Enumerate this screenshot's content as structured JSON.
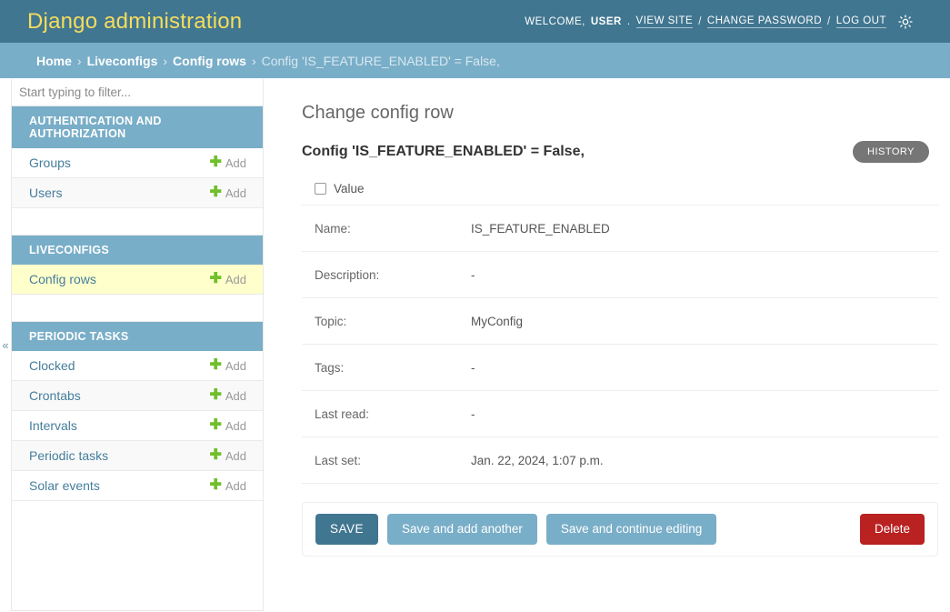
{
  "header": {
    "site_title": "Django administration",
    "welcome_prefix": "WELCOME,",
    "username": "USER",
    "username_suffix": ".",
    "view_site": "VIEW SITE",
    "sep1": "/",
    "change_password": "CHANGE PASSWORD",
    "sep2": "/",
    "log_out": "LOG OUT",
    "theme_icon": "sun-icon",
    "bg_color": "#417690",
    "brand_color": "#f5dd5d"
  },
  "breadcrumbs": {
    "items": [
      {
        "label": "Home",
        "current": false
      },
      {
        "label": "Liveconfigs",
        "current": false
      },
      {
        "label": "Config rows",
        "current": false
      },
      {
        "label": "Config 'IS_FEATURE_ENABLED' = False,",
        "current": true
      }
    ],
    "separator": "›",
    "bg_color": "#79aec8"
  },
  "sidebar": {
    "filter_placeholder": "Start typing to filter...",
    "filter_value": "",
    "collapse_icon": "«",
    "apps": [
      {
        "caption": "AUTHENTICATION AND AUTHORIZATION",
        "models": [
          {
            "name": "Groups",
            "add_label": "Add",
            "current": false
          },
          {
            "name": "Users",
            "add_label": "Add",
            "current": false
          }
        ]
      },
      {
        "caption": "LIVECONFIGS",
        "models": [
          {
            "name": "Config rows",
            "add_label": "Add",
            "current": true
          }
        ]
      },
      {
        "caption": "PERIODIC TASKS",
        "models": [
          {
            "name": "Clocked",
            "add_label": "Add",
            "current": false
          },
          {
            "name": "Crontabs",
            "add_label": "Add",
            "current": false
          },
          {
            "name": "Intervals",
            "add_label": "Add",
            "current": false
          },
          {
            "name": "Periodic tasks",
            "add_label": "Add",
            "current": false
          },
          {
            "name": "Solar events",
            "add_label": "Add",
            "current": false
          }
        ]
      }
    ],
    "current_highlight_color": "#ffffcc"
  },
  "main": {
    "page_title": "Change config row",
    "history_label": "HISTORY",
    "object_title": "Config 'IS_FEATURE_ENABLED' = False,",
    "value_checkbox": {
      "label": "Value",
      "checked": false
    },
    "fields": [
      {
        "label": "Name:",
        "value": "IS_FEATURE_ENABLED"
      },
      {
        "label": "Description:",
        "value": "-"
      },
      {
        "label": "Topic:",
        "value": "MyConfig"
      },
      {
        "label": "Tags:",
        "value": "-"
      },
      {
        "label": "Last read:",
        "value": "-"
      },
      {
        "label": "Last set:",
        "value": "Jan. 22, 2024, 1:07 p.m."
      }
    ],
    "buttons": {
      "save": "SAVE",
      "save_and_add_another": "Save and add another",
      "save_and_continue": "Save and continue editing",
      "delete": "Delete"
    },
    "colors": {
      "save": "#417690",
      "save_light": "#79aec8",
      "delete": "#ba2121",
      "history": "#767676"
    }
  }
}
